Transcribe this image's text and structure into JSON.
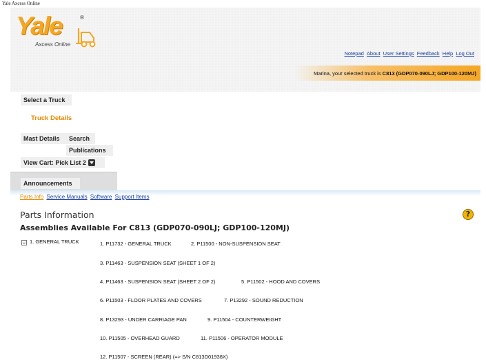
{
  "window": {
    "title": "Yale Axcess Online"
  },
  "header": {
    "logo_word": "Yale",
    "logo_reg": "®",
    "logo_sub": "Axcess Online",
    "links": [
      "Notepad",
      "About",
      "User Settings",
      "Feedback",
      "Help",
      "Log Out"
    ],
    "truck_prefix": "Marina, your selected truck is ",
    "truck_selected": "C813 (GDP070-090LJ; GDP100-120MJ)"
  },
  "nav": {
    "select_truck": "Select a Truck",
    "truck_details": "Truck Details",
    "mast_details": "Mast Details",
    "search": "Search",
    "publications": "Publications",
    "view_cart": "View Cart: Pick List 2",
    "announcements": "Announcements"
  },
  "tabs": [
    "Parts Info",
    "Service Manuals",
    "Software",
    "Support Items"
  ],
  "main": {
    "title": "Parts Information",
    "help": "?",
    "subtitle": "Assemblies Available For C813 (GDP070-090LJ; GDP100-120MJ)",
    "group": "1. GENERAL TRUCK",
    "parts": [
      "1. P11732 - GENERAL TRUCK",
      "2. P11500 - NON-SUSPENSION SEAT",
      "3. P11463 - SUSPENSION SEAT (SHEET 1 OF 2)",
      "4. P11463 - SUSPENSION SEAT (SHEET 2 OF 2)",
      "5. P11502 - HOOD AND COVERS",
      "6. P11503 - FLOOR PLATES AND COVERS",
      "7. P13292 - SOUND REDUCTION",
      "8. P13293 - UNDER CARRIAGE PAN",
      "9. P11504 - COUNTERWEIGHT",
      "10. P11505 - OVERHEAD GUARD",
      "11. P11506 - OPERATOR MODULE",
      "12. P11507 - SCREEN (REAR) (=> S/N C813D01938X)"
    ]
  },
  "colors": {
    "accent": "#f5a623",
    "link": "#1a3fa0",
    "active": "#e58a00"
  }
}
